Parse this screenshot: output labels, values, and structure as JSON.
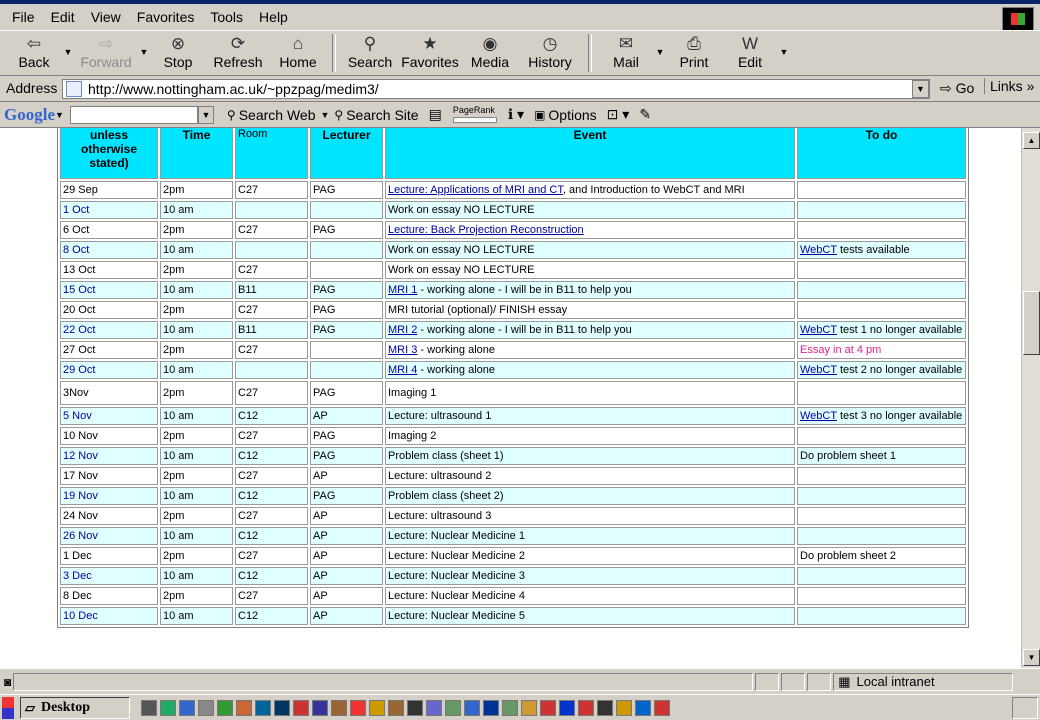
{
  "menu": [
    "File",
    "Edit",
    "View",
    "Favorites",
    "Tools",
    "Help"
  ],
  "toolbar": [
    {
      "label": "Back",
      "icon": "back-arrow-icon",
      "glyph": "⇦",
      "drop": true
    },
    {
      "label": "Forward",
      "icon": "forward-arrow-icon",
      "glyph": "⇨",
      "drop": true,
      "disabled": true
    },
    {
      "label": "Stop",
      "icon": "stop-icon",
      "glyph": "⊗"
    },
    {
      "label": "Refresh",
      "icon": "refresh-icon",
      "glyph": "⟳"
    },
    {
      "label": "Home",
      "icon": "home-icon",
      "glyph": "⌂",
      "sep_after": true
    },
    {
      "label": "Search",
      "icon": "search-icon",
      "glyph": "⚲"
    },
    {
      "label": "Favorites",
      "icon": "favorites-icon",
      "glyph": "★"
    },
    {
      "label": "Media",
      "icon": "media-icon",
      "glyph": "◉"
    },
    {
      "label": "History",
      "icon": "history-icon",
      "glyph": "◷",
      "sep_after": true
    },
    {
      "label": "Mail",
      "icon": "mail-icon",
      "glyph": "✉",
      "drop": true
    },
    {
      "label": "Print",
      "icon": "print-icon",
      "glyph": "⎙"
    },
    {
      "label": "Edit",
      "icon": "edit-icon",
      "glyph": "W",
      "drop": true
    }
  ],
  "address": {
    "label": "Address",
    "url": "http://www.nottingham.ac.uk/~ppzpag/medim3/",
    "go": "Go",
    "links": "Links"
  },
  "google": {
    "logo": "Google",
    "search_web": "Search Web",
    "search_site": "Search Site",
    "pagerank": "PageRank",
    "options": "Options"
  },
  "table": {
    "headers": [
      "unless otherwise stated)",
      "Time",
      "Room",
      "Lecturer",
      "Event",
      "To do"
    ],
    "rows": [
      {
        "date": "29 Sep",
        "time": "2pm",
        "room": "C27",
        "lecturer": "PAG",
        "event_link": "Lecture: Applications of MRI and CT",
        "event_text": ", and Introduction to WebCT and MRI",
        "todo_link": "",
        "todo_text": "",
        "cyan": false
      },
      {
        "date": "1 Oct",
        "time": "10 am",
        "room": "",
        "lecturer": "",
        "event_link": "",
        "event_text": "Work on essay NO LECTURE",
        "todo_link": "",
        "todo_text": "",
        "cyan": true
      },
      {
        "date": "6 Oct",
        "time": "2pm",
        "room": "C27",
        "lecturer": "PAG",
        "event_link": "Lecture: Back Projection Reconstruction",
        "event_text": "",
        "todo_link": "",
        "todo_text": "",
        "cyan": false
      },
      {
        "date": "8 Oct",
        "time": "10 am",
        "room": "",
        "lecturer": "",
        "event_link": "",
        "event_text": "Work on essay NO LECTURE",
        "todo_link": "WebCT",
        "todo_text": " tests available",
        "cyan": true
      },
      {
        "date": "13 Oct",
        "time": "2pm",
        "room": "C27",
        "lecturer": "",
        "event_link": "",
        "event_text": "Work on essay NO LECTURE",
        "todo_link": "",
        "todo_text": "",
        "cyan": false
      },
      {
        "date": "15 Oct",
        "time": "10 am",
        "room": "B11",
        "lecturer": "PAG",
        "event_link": "MRI 1",
        "event_text": " - working alone - I will be in B11 to help you",
        "todo_link": "",
        "todo_text": "",
        "cyan": true
      },
      {
        "date": "20 Oct",
        "time": "2pm",
        "room": "C27",
        "lecturer": "PAG",
        "event_link": "",
        "event_text": "MRI tutorial (optional)/ FINISH essay",
        "todo_link": "",
        "todo_text": "",
        "cyan": false
      },
      {
        "date": "22 Oct",
        "time": "10 am",
        "room": "B11",
        "lecturer": "PAG",
        "event_link": "MRI 2",
        "event_text": " - working alone - I will be in B11 to help you",
        "todo_link": "WebCT",
        "todo_text": " test 1 no longer available",
        "cyan": true
      },
      {
        "date": "27 Oct",
        "time": "2pm",
        "room": "C27",
        "lecturer": "",
        "event_link": "MRI 3",
        "event_text": " - working alone",
        "todo_link": "",
        "todo_text": "Essay in at 4 pm",
        "todo_pink": true,
        "cyan": false
      },
      {
        "date": "29 Oct",
        "time": "10 am",
        "room": "",
        "lecturer": "",
        "event_link": "MRI 4",
        "event_text": " - working alone",
        "todo_link": "WebCT",
        "todo_text": " test 2 no longer available",
        "cyan": true
      },
      {
        "date": "3Nov",
        "time": "2pm",
        "room": "C27",
        "lecturer": "PAG",
        "event_link": "",
        "event_text": "Imaging 1",
        "todo_link": "",
        "todo_text": "",
        "cyan": false,
        "tall": true
      },
      {
        "date": "5 Nov",
        "time": "10 am",
        "room": "C12",
        "lecturer": "AP",
        "event_link": "",
        "event_text": "Lecture: ultrasound 1",
        "todo_link": "WebCT",
        "todo_text": " test 3 no longer available",
        "cyan": true
      },
      {
        "date": "10 Nov",
        "time": "2pm",
        "room": "C27",
        "lecturer": "PAG",
        "event_link": "",
        "event_text": "Imaging 2",
        "todo_link": "",
        "todo_text": "",
        "cyan": false
      },
      {
        "date": "12 Nov",
        "time": "10 am",
        "room": "C12",
        "lecturer": "PAG",
        "event_link": "",
        "event_text": "Problem class (sheet 1)",
        "todo_link": "",
        "todo_text": "Do problem sheet 1",
        "cyan": true
      },
      {
        "date": "17 Nov",
        "time": "2pm",
        "room": "C27",
        "lecturer": "AP",
        "event_link": "",
        "event_text": "Lecture: ultrasound 2",
        "todo_link": "",
        "todo_text": "",
        "cyan": false
      },
      {
        "date": "19 Nov",
        "time": "10 am",
        "room": "C12",
        "lecturer": "PAG",
        "event_link": "",
        "event_text": "Problem class (sheet 2)",
        "todo_link": "",
        "todo_text": "",
        "cyan": true
      },
      {
        "date": "24 Nov",
        "time": "2pm",
        "room": "C27",
        "lecturer": "AP",
        "event_link": "",
        "event_text": "Lecture: ultrasound 3",
        "todo_link": "",
        "todo_text": "",
        "cyan": false
      },
      {
        "date": "26 Nov",
        "time": "10 am",
        "room": "C12",
        "lecturer": "AP",
        "event_link": "",
        "event_text": "Lecture: Nuclear Medicine 1",
        "todo_link": "",
        "todo_text": "",
        "cyan": true
      },
      {
        "date": "1 Dec",
        "time": "2pm",
        "room": "C27",
        "lecturer": "AP",
        "event_link": "",
        "event_text": "Lecture: Nuclear Medicine 2",
        "todo_link": "",
        "todo_text": "Do problem sheet 2",
        "cyan": false
      },
      {
        "date": "3 Dec",
        "time": "10 am",
        "room": "C12",
        "lecturer": "AP",
        "event_link": "",
        "event_text": "Lecture: Nuclear Medicine 3",
        "todo_link": "",
        "todo_text": "",
        "cyan": true
      },
      {
        "date": "8 Dec",
        "time": "2pm",
        "room": "C27",
        "lecturer": "AP",
        "event_link": "",
        "event_text": "Lecture: Nuclear Medicine 4",
        "todo_link": "",
        "todo_text": "",
        "cyan": false
      },
      {
        "date": "10 Dec",
        "time": "10 am",
        "room": "C12",
        "lecturer": "AP",
        "event_link": "",
        "event_text": "Lecture: Nuclear Medicine 5",
        "todo_link": "",
        "todo_text": "",
        "cyan": true
      }
    ]
  },
  "status": {
    "zone": "Local intranet"
  },
  "taskbar": {
    "desktop": "Desktop",
    "quick_icons": [
      "#555",
      "#2a6",
      "#36c",
      "#888",
      "#393",
      "#c63",
      "#069",
      "#036",
      "#c33",
      "#339",
      "#963",
      "#e33",
      "#c90",
      "#963",
      "#333",
      "#66c",
      "#696",
      "#36c",
      "#039",
      "#696",
      "#c93",
      "#c33",
      "#03c",
      "#c33",
      "#333",
      "#c90",
      "#06c",
      "#c33"
    ]
  },
  "colors": {
    "header_cyan": "#00e5ff",
    "row_cyan": "#e0ffff",
    "link": "#0000a0",
    "pink": "#e0208a"
  }
}
